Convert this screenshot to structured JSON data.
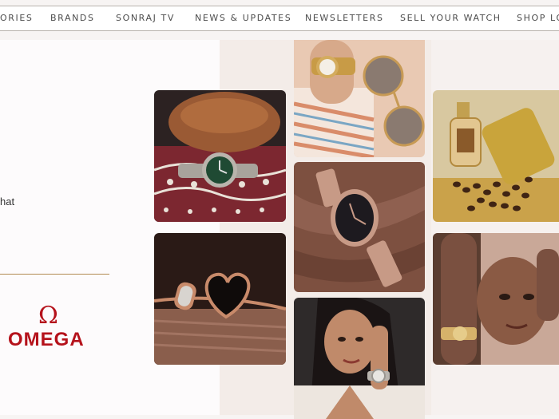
{
  "nav": {
    "items": [
      "ORIES",
      "BRANDS",
      "SONRAJ TV",
      "NEWS & UPDATES",
      "NEWSLETTERS",
      "SELL YOUR WATCH",
      "SHOP LO"
    ]
  },
  "intro": {
    "teaser_text": "hat"
  },
  "brand_logo": {
    "wordmark": "OMEGA",
    "symbol": "Ω",
    "color": "#b5121b"
  },
  "gallery": {
    "tiles": [
      {
        "id": "green-dial-watch-on-textile"
      },
      {
        "id": "wrist-with-sunglasses"
      },
      {
        "id": "perfume-and-coffee-beans"
      },
      {
        "id": "heart-bangle-bracelet"
      },
      {
        "id": "rose-gold-watch-on-silk"
      },
      {
        "id": "woman-hand-on-face"
      },
      {
        "id": "woman-wearing-watch"
      }
    ]
  },
  "colors": {
    "accent_gold": "#b28a52",
    "nav_text": "#4d4d4d"
  }
}
